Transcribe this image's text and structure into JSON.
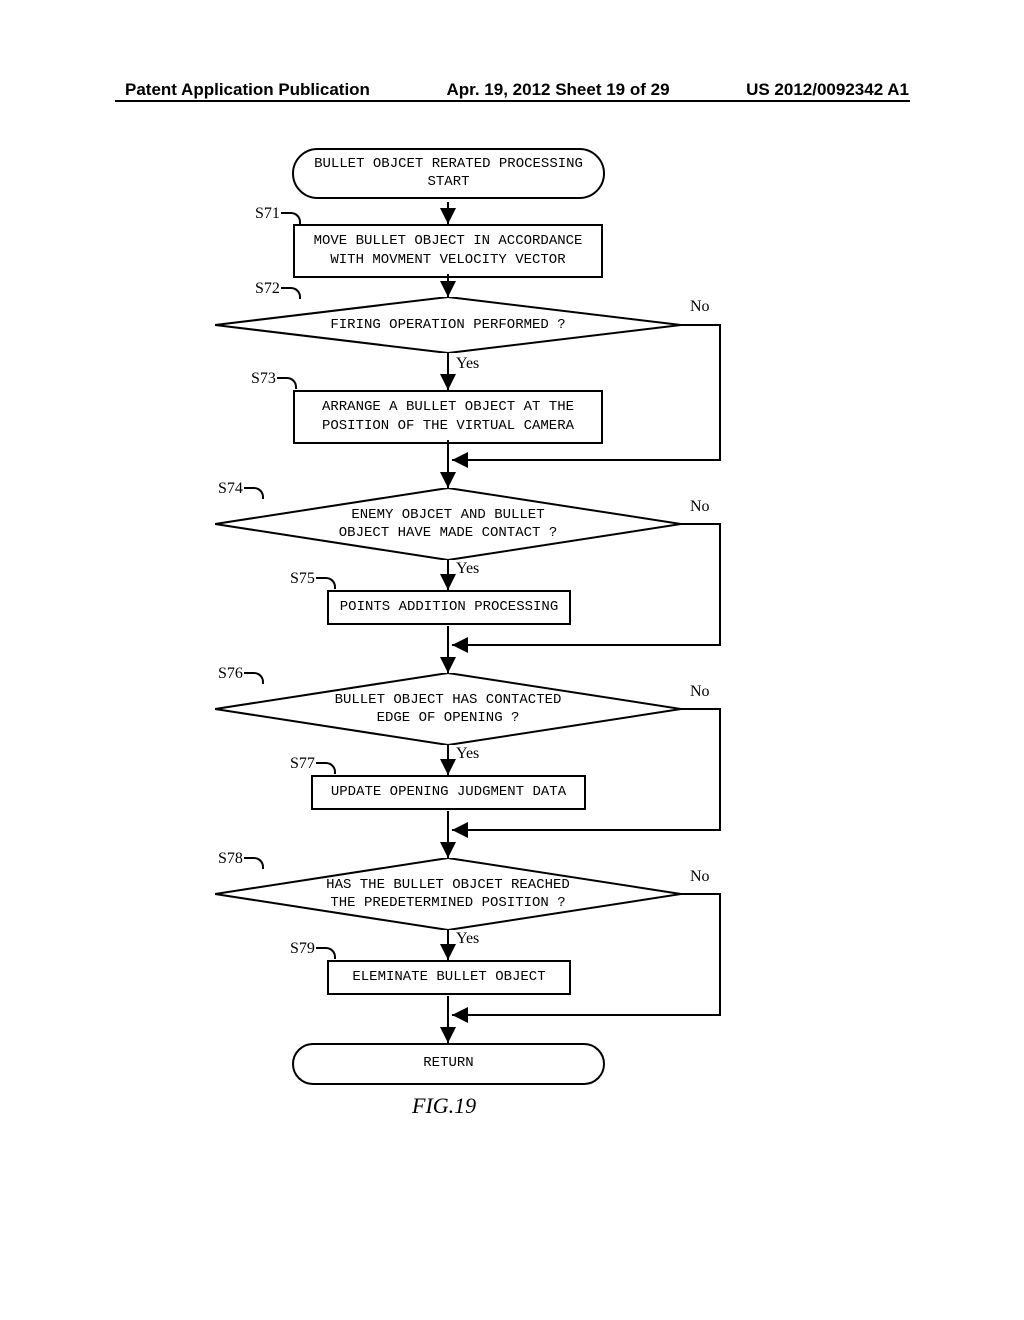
{
  "header": {
    "left": "Patent Application Publication",
    "center": "Apr. 19, 2012  Sheet 19 of 29",
    "right": "US 2012/0092342 A1"
  },
  "figure_label": "FIG.19",
  "blocks": {
    "start": "BULLET OBJCET RERATED PROCESSING\nSTART",
    "s71": "MOVE BULLET OBJECT IN ACCORDANCE\nWITH MOVMENT VELOCITY VECTOR",
    "s72": "FIRING OPERATION PERFORMED ?",
    "s73": "ARRANGE A BULLET OBJECT AT THE\nPOSITION OF THE VIRTUAL CAMERA",
    "s74": "ENEMY OBJCET AND BULLET\nOBJECT HAVE MADE CONTACT ?",
    "s75": "POINTS ADDITION PROCESSING",
    "s76": "BULLET OBJECT HAS CONTACTED\nEDGE OF OPENING ?",
    "s77": "UPDATE OPENING JUDGMENT DATA",
    "s78": "HAS THE BULLET OBJCET REACHED\nTHE PREDETERMINED POSITION ?",
    "s79": "ELEMINATE BULLET OBJECT",
    "return": "RETURN"
  },
  "steps": {
    "s71": "S71",
    "s72": "S72",
    "s73": "S73",
    "s74": "S74",
    "s75": "S75",
    "s76": "S76",
    "s77": "S77",
    "s78": "S78",
    "s79": "S79"
  },
  "labels": {
    "yes": "Yes",
    "no": "No"
  }
}
